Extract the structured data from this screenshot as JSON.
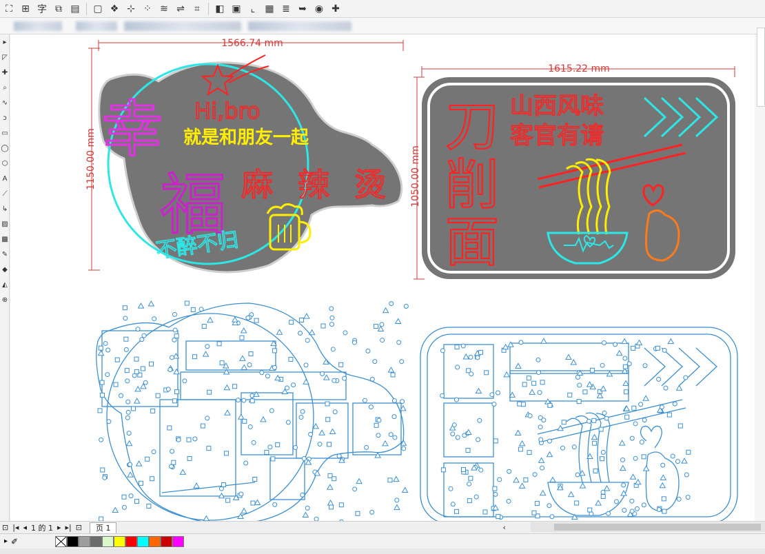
{
  "toolbar": {
    "buttons": [
      {
        "name": "group-icon",
        "glyph": "⛶"
      },
      {
        "name": "align-icon",
        "glyph": "⊞"
      },
      {
        "name": "text-icon",
        "glyph": "字"
      },
      {
        "name": "arrange-icon",
        "glyph": "⧉"
      },
      {
        "name": "layer-icon",
        "glyph": "▤"
      },
      {
        "name": "frame-icon",
        "glyph": "▢"
      },
      {
        "name": "gift-icon",
        "glyph": "❖"
      },
      {
        "name": "node-edit-icon",
        "glyph": "⊹"
      },
      {
        "name": "dots-icon",
        "glyph": "⁘"
      },
      {
        "name": "wave-icon",
        "glyph": "≋"
      },
      {
        "name": "mirror-icon",
        "glyph": "⇌"
      },
      {
        "name": "scan-icon",
        "glyph": "⌗"
      },
      {
        "name": "color-node-icon",
        "glyph": "◧"
      },
      {
        "name": "image-icon",
        "glyph": "▣"
      },
      {
        "name": "crop-icon",
        "glyph": "⌞"
      },
      {
        "name": "folder-icon",
        "glyph": "▦"
      },
      {
        "name": "ruler-icon",
        "glyph": "≣"
      },
      {
        "name": "arrow-icon",
        "glyph": "➥"
      },
      {
        "name": "ball-icon",
        "glyph": "◉"
      },
      {
        "name": "puzzle-icon",
        "glyph": "✚"
      }
    ]
  },
  "designs": {
    "left": {
      "width_label": "1566.74 mm",
      "height_label": "1150.00 mm",
      "big_chars": [
        "幸",
        "福"
      ],
      "hi": "Hi,bro",
      "line1": "就是和朋友一起",
      "mala": [
        "麻",
        "辣",
        "烫"
      ],
      "slogan": "不醉不归",
      "colors": {
        "board": "#757575",
        "magenta": "#e531e5",
        "cyan": "#2ee6e6",
        "red": "#ff2222",
        "yellow": "#ffee00",
        "purple": "#cc22cc"
      }
    },
    "right": {
      "width_label": "1615.22 mm",
      "height_label": "1050.00 mm",
      "vertical": [
        "刀",
        "削",
        "面"
      ],
      "line1": "山西风味",
      "line2": "客官有请",
      "colors": {
        "board": "#757575",
        "red": "#ff2222",
        "yellow": "#ffee00",
        "cyan": "#2ee6e6",
        "orange": "#ff7a1a"
      }
    },
    "outline_color": "#3b8fd1"
  },
  "pagebar": {
    "page_of": "1 的 1",
    "tab_label": "页 1"
  },
  "palette": [
    "#ffffff",
    "#000000",
    "#9e9e9e",
    "#6b6b6b",
    "#d9f7c9",
    "#ffff00",
    "#ff0000",
    "#00ffff",
    "#ff6600",
    "#cc0000",
    "#ff00ff"
  ]
}
